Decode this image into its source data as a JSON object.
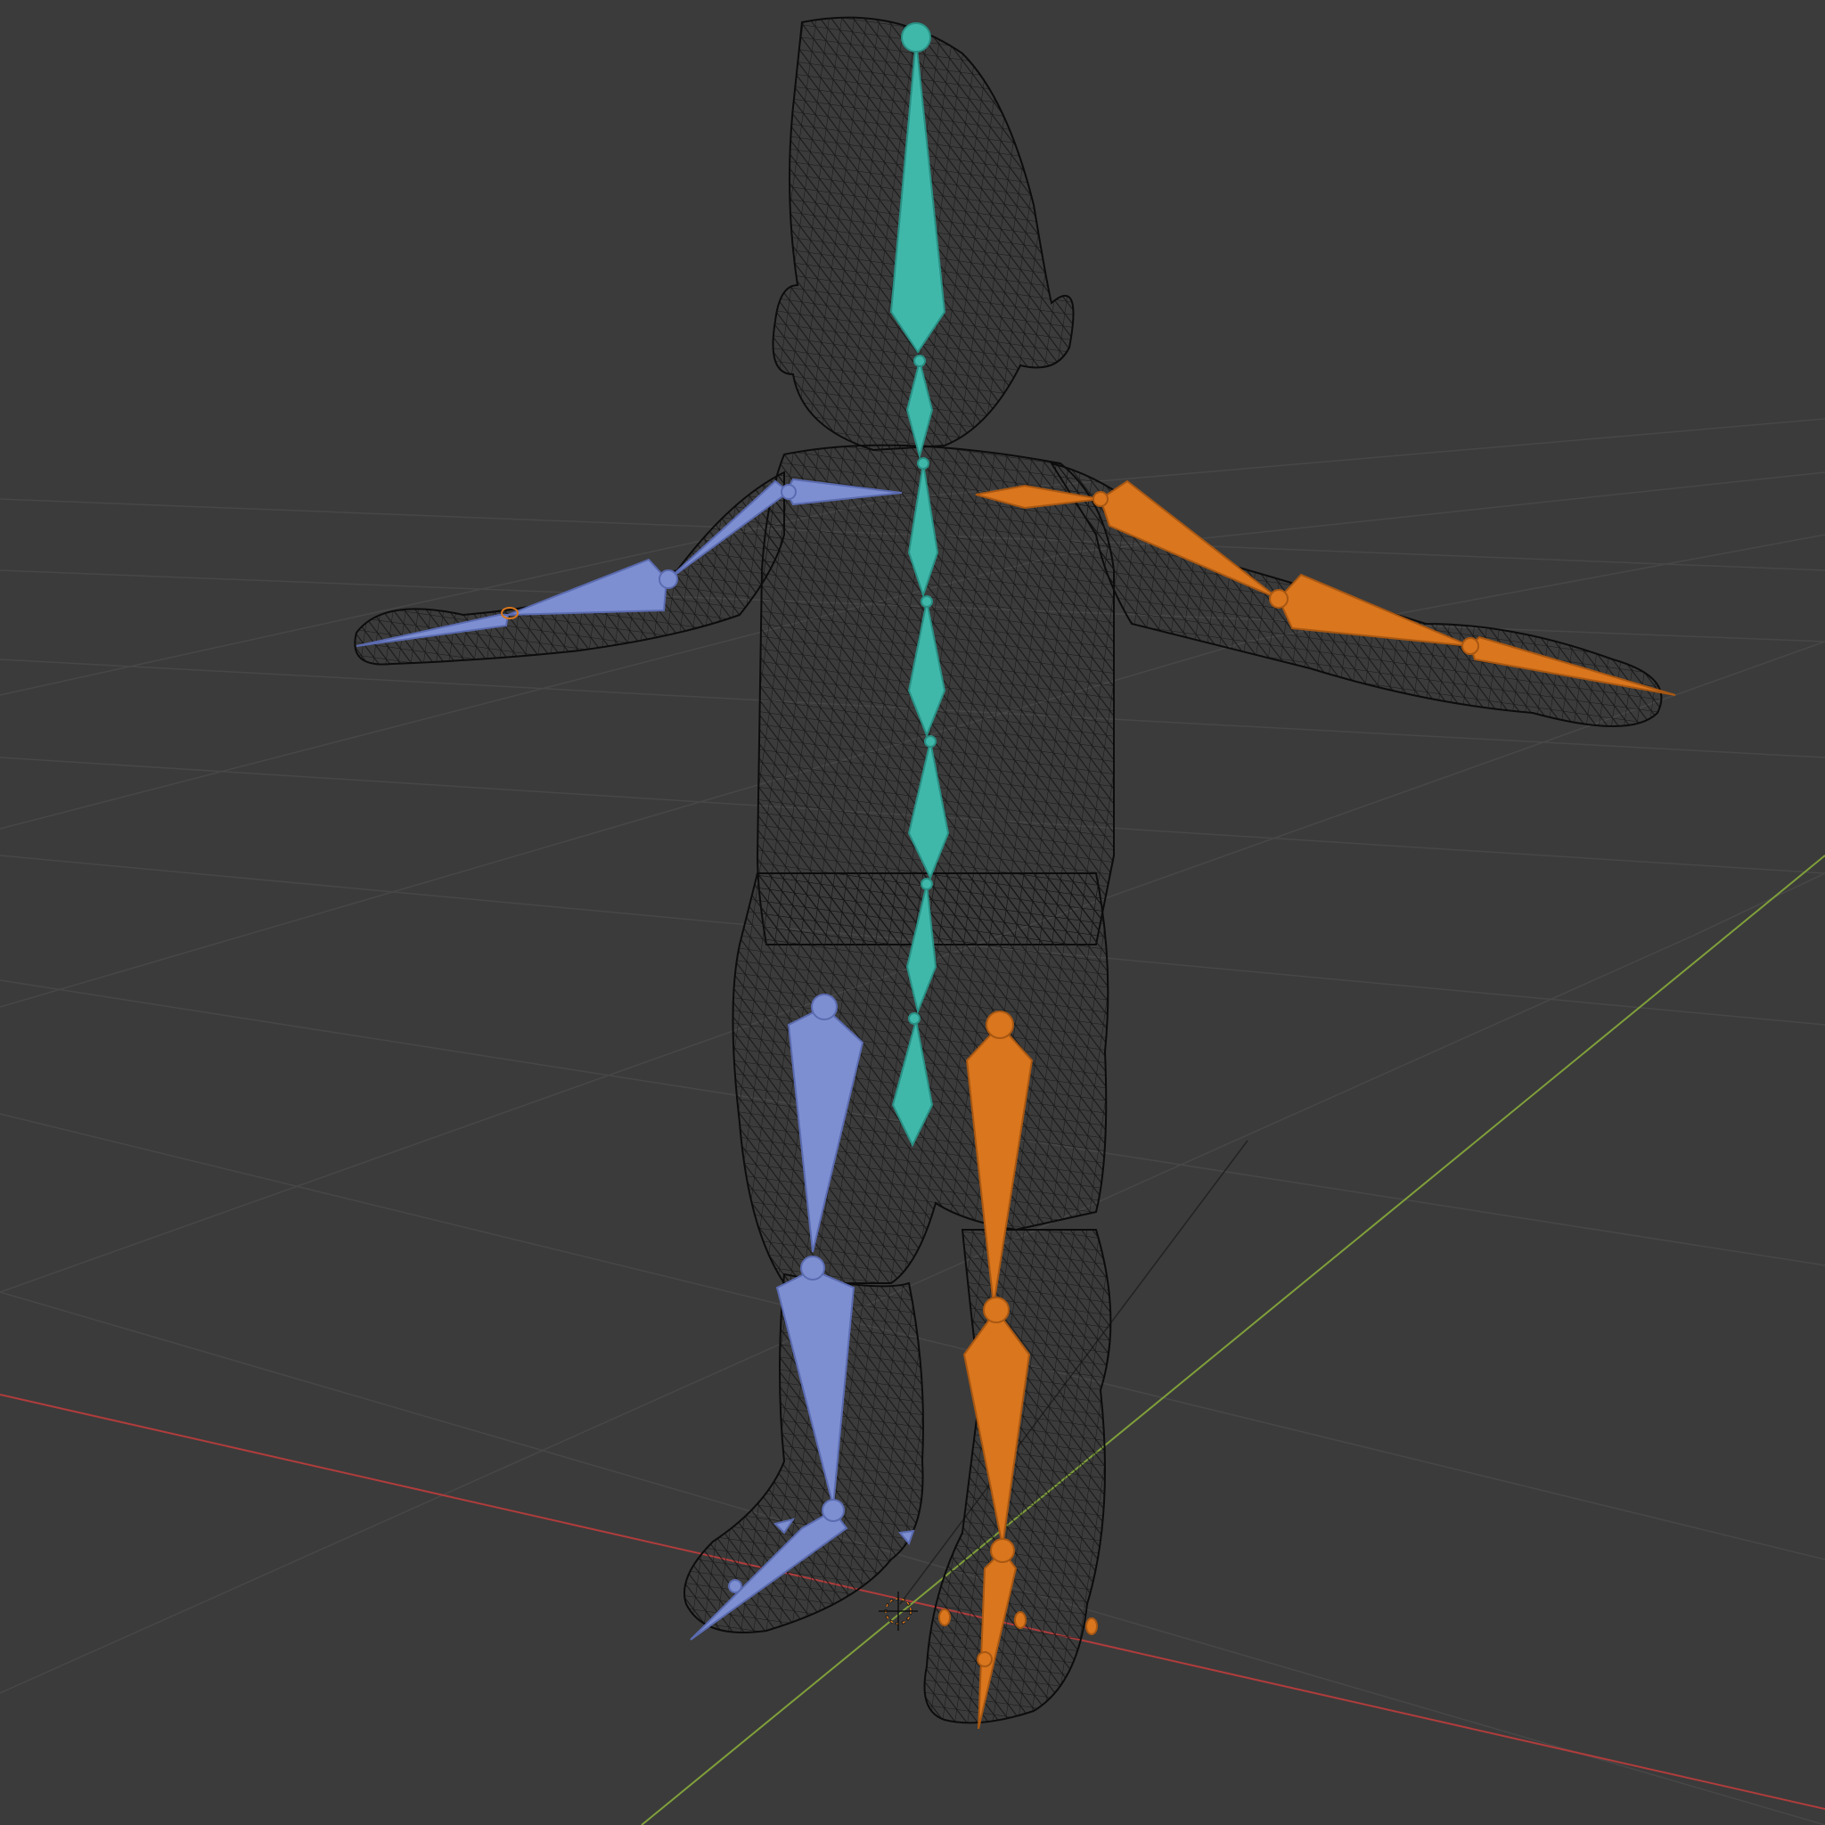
{
  "viewport": {
    "mode": "wireframe",
    "background_color": "#3b3b3b",
    "grid_color": "#4a4a4a",
    "axis_x_color": "#a83a3a",
    "axis_y_color": "#7a9a3a",
    "mesh_color": "#111111"
  },
  "armature": {
    "center_color": "#3fb8aa",
    "left_color": "#7d8fd1",
    "right_color": "#d9761e",
    "bones": [
      "head",
      "neck",
      "spine-upper",
      "spine-chest",
      "spine-mid",
      "spine-low",
      "pelvis",
      "clavicle-l",
      "upperarm-l",
      "forearm-l",
      "hand-l",
      "clavicle-r",
      "upperarm-r",
      "forearm-r",
      "hand-r",
      "thigh-l",
      "shin-l",
      "foot-l",
      "thigh-r",
      "shin-r",
      "foot-r"
    ]
  },
  "icons": [
    "3d-cursor-icon"
  ]
}
